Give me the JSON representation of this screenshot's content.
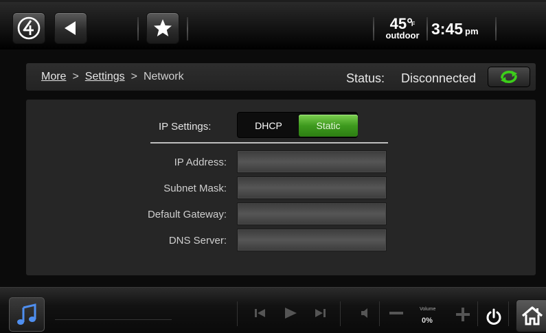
{
  "topbar": {
    "temperature": "45°",
    "temperature_unit": "F",
    "temperature_label": "outdoor",
    "time": "3:45",
    "ampm": "pm"
  },
  "breadcrumb": {
    "items": [
      "More",
      "Settings",
      "Network"
    ],
    "separator": ">"
  },
  "status": {
    "label": "Status:",
    "value": "Disconnected"
  },
  "ip_settings": {
    "label": "IP Settings:",
    "options": [
      "DHCP",
      "Static"
    ],
    "selected": "Static"
  },
  "fields": [
    {
      "label": "IP Address:",
      "value": ""
    },
    {
      "label": "Subnet Mask:",
      "value": ""
    },
    {
      "label": "Default Gateway:",
      "value": ""
    },
    {
      "label": "DNS Server:",
      "value": ""
    }
  ],
  "player": {
    "volume_label": "Volume",
    "volume_value": "0%"
  },
  "colors": {
    "accent_green": "#3e9a1e",
    "refresh_green": "#3ccf1a"
  },
  "icons": [
    "control4-logo-icon",
    "back-arrow-icon",
    "star-icon",
    "refresh-icon",
    "music-note-icon",
    "previous-track-icon",
    "play-icon",
    "next-track-icon",
    "mute-icon",
    "volume-down-icon",
    "volume-up-icon",
    "power-icon",
    "home-icon"
  ]
}
